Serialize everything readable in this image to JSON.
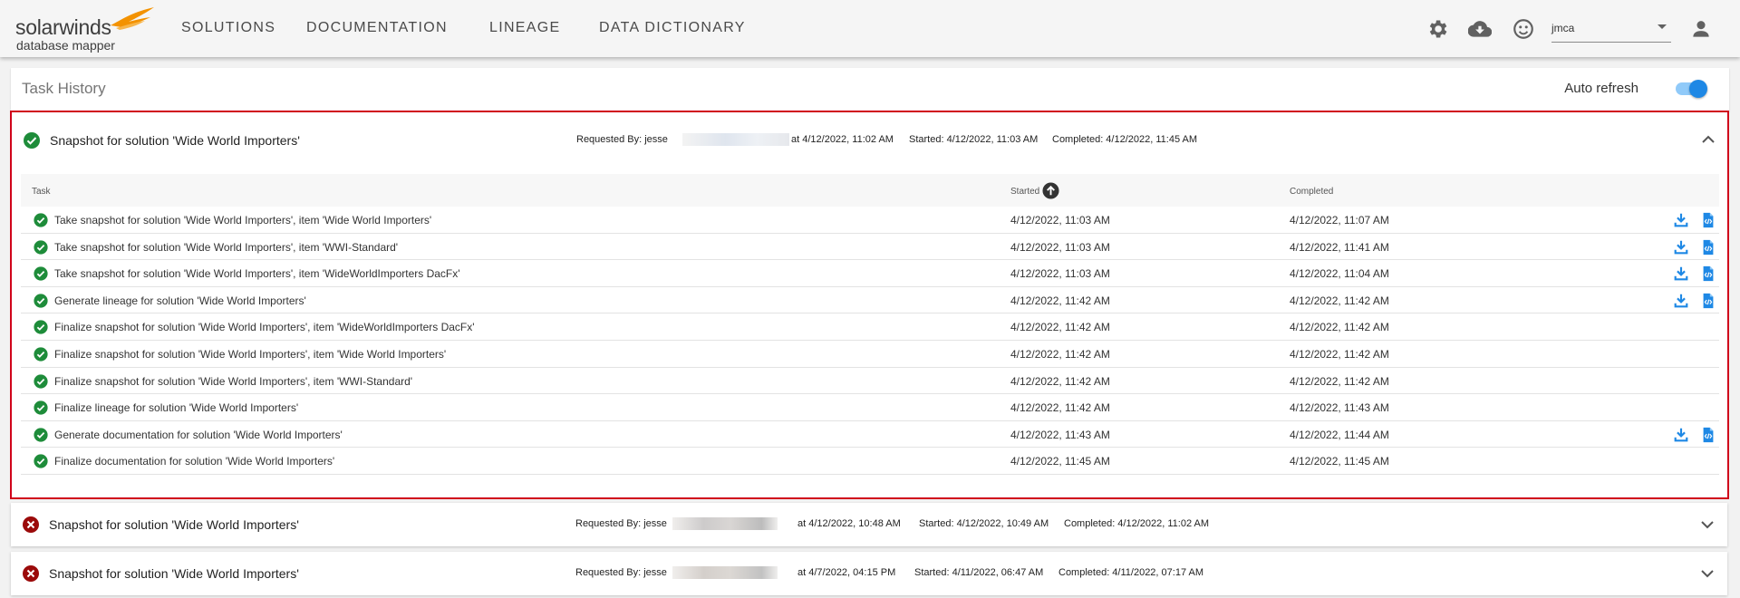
{
  "app": {
    "brand": "solarwinds",
    "product": "database mapper"
  },
  "nav": {
    "items": [
      "SOLUTIONS",
      "DOCUMENTATION",
      "LINEAGE",
      "DATA DICTIONARY"
    ]
  },
  "toolbar": {
    "icons": [
      "gear-icon",
      "cloud-download-icon",
      "smiley-icon",
      "account-icon"
    ],
    "user_value": "jmca"
  },
  "history": {
    "title": "Task History",
    "auto_refresh_label": "Auto refresh",
    "auto_refresh_on": true
  },
  "runs": [
    {
      "status": "success",
      "title": "Snapshot for solution 'Wide World Importers'",
      "requested_by": "Requested By: jesse",
      "requested_at": "at 4/12/2022, 11:02 AM",
      "started": "Started: 4/12/2022, 11:03 AM",
      "completed": "Completed: 4/12/2022, 11:45 AM",
      "expanded": true
    },
    {
      "status": "error",
      "title": "Snapshot for solution 'Wide World Importers'",
      "requested_by": "Requested By: jesse",
      "requested_at": "at 4/12/2022, 10:48 AM",
      "started": "Started: 4/12/2022, 10:49 AM",
      "completed": "Completed: 4/12/2022, 11:02 AM",
      "expanded": false
    },
    {
      "status": "error",
      "title": "Snapshot for solution 'Wide World Importers'",
      "requested_by": "Requested By: jesse",
      "requested_at": "at 4/7/2022, 04:15 PM",
      "started": "Started: 4/11/2022, 06:47 AM",
      "completed": "Completed: 4/11/2022, 07:17 AM",
      "expanded": false
    }
  ],
  "tasks_table": {
    "headers": {
      "task": "Task",
      "started": "Started",
      "completed": "Completed"
    },
    "sort": {
      "column": "Started",
      "direction": "ascending"
    },
    "rows": [
      {
        "task": "Take snapshot for solution 'Wide World Importers', item 'Wide World Importers'",
        "started": "4/12/2022, 11:03 AM",
        "completed": "4/12/2022, 11:07 AM",
        "has_actions": true
      },
      {
        "task": "Take snapshot for solution 'Wide World Importers', item 'WWI-Standard'",
        "started": "4/12/2022, 11:03 AM",
        "completed": "4/12/2022, 11:41 AM",
        "has_actions": true
      },
      {
        "task": "Take snapshot for solution 'Wide World Importers', item 'WideWorldImporters DacFx'",
        "started": "4/12/2022, 11:03 AM",
        "completed": "4/12/2022, 11:04 AM",
        "has_actions": true
      },
      {
        "task": "Generate lineage for solution 'Wide World Importers'",
        "started": "4/12/2022, 11:42 AM",
        "completed": "4/12/2022, 11:42 AM",
        "has_actions": true
      },
      {
        "task": "Finalize snapshot for solution 'Wide World Importers', item 'WideWorldImporters DacFx'",
        "started": "4/12/2022, 11:42 AM",
        "completed": "4/12/2022, 11:42 AM",
        "has_actions": false
      },
      {
        "task": "Finalize snapshot for solution 'Wide World Importers', item 'Wide World Importers'",
        "started": "4/12/2022, 11:42 AM",
        "completed": "4/12/2022, 11:42 AM",
        "has_actions": false
      },
      {
        "task": "Finalize snapshot for solution 'Wide World Importers', item 'WWI-Standard'",
        "started": "4/12/2022, 11:42 AM",
        "completed": "4/12/2022, 11:42 AM",
        "has_actions": false
      },
      {
        "task": "Finalize lineage for solution 'Wide World Importers'",
        "started": "4/12/2022, 11:42 AM",
        "completed": "4/12/2022, 11:43 AM",
        "has_actions": false
      },
      {
        "task": "Generate documentation for solution 'Wide World Importers'",
        "started": "4/12/2022, 11:43 AM",
        "completed": "4/12/2022, 11:44 AM",
        "has_actions": true
      },
      {
        "task": "Finalize documentation for solution 'Wide World Importers'",
        "started": "4/12/2022, 11:45 AM",
        "completed": "4/12/2022, 11:45 AM",
        "has_actions": false
      }
    ]
  },
  "colors": {
    "success": "#1e8c3a",
    "error": "#9b0a0a",
    "accent": "#1e88e5",
    "highlight_border": "#d0021b"
  }
}
